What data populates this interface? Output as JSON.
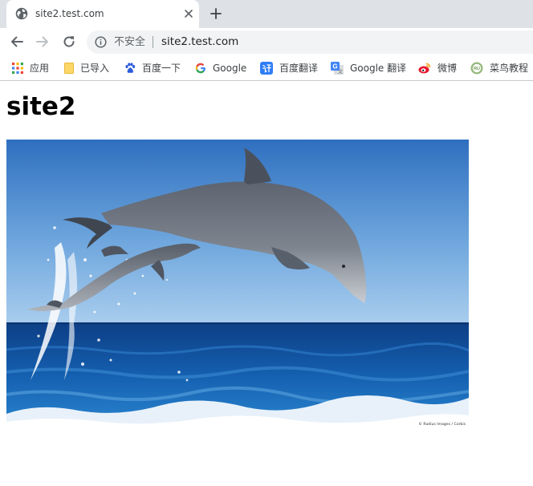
{
  "tab": {
    "title": "site2.test.com",
    "favicon": "globe-icon"
  },
  "toolbar": {
    "security_label": "不安全",
    "url": "site2.test.com"
  },
  "bookmarks": [
    {
      "label": "应用",
      "icon": "apps-grid-icon"
    },
    {
      "label": "已导入",
      "icon": "folder-icon"
    },
    {
      "label": "百度一下",
      "icon": "baidu-paw-icon"
    },
    {
      "label": "Google",
      "icon": "google-g-icon"
    },
    {
      "label": "百度翻译",
      "icon": "baidu-translate-icon"
    },
    {
      "label": "Google 翻译",
      "icon": "google-translate-icon"
    },
    {
      "label": "微博",
      "icon": "weibo-icon"
    },
    {
      "label": "菜鸟教程",
      "icon": "runoob-icon"
    }
  ],
  "page": {
    "heading": "site2",
    "image": {
      "subject": "dolphin-photo",
      "credit": "© Radius Images / Corbis"
    }
  }
}
